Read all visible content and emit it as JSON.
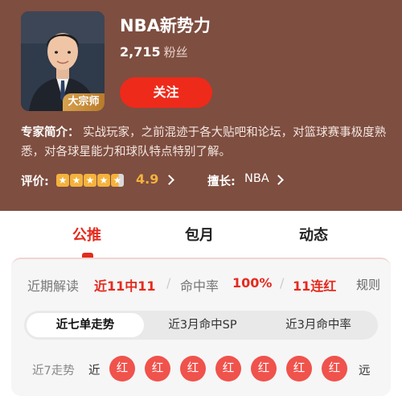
{
  "expert": {
    "name": "NBA新势力",
    "fans_count": "2,715",
    "fans_label": "粉丝",
    "badge": "大宗师",
    "follow_label": "关注"
  },
  "intro": {
    "label": "专家简介：",
    "text": "实战玩家，之前混迹于各大贴吧和论坛，对篮球赛事极度熟悉，对各球星能力和球队特点特别了解。"
  },
  "rating": {
    "label": "评价:",
    "stars": 4.5,
    "score": "4.9",
    "good_at_label": "擅长:",
    "good_at_value": "NBA"
  },
  "tabs": [
    "公推",
    "包月",
    "动态"
  ],
  "active_tab": 0,
  "stats": {
    "recent_label": "近期解读",
    "recent_value": "近11中11",
    "hit_rate_label": "命中率",
    "hit_rate_value": "100%",
    "streak_value": "11连红",
    "rules_label": "规则"
  },
  "segments": [
    "近七单走势",
    "近3月命中SP",
    "近3月命中率"
  ],
  "active_segment": 0,
  "trend": {
    "label": "近7走势",
    "near": "近",
    "far": "远",
    "results": [
      "红",
      "红",
      "红",
      "红",
      "红",
      "红",
      "红"
    ]
  },
  "colors": {
    "header_bg": "#7e4e40",
    "accent_red": "#e52a1e",
    "star_gold": "#f4b23d",
    "ball_red": "#f0524c"
  }
}
